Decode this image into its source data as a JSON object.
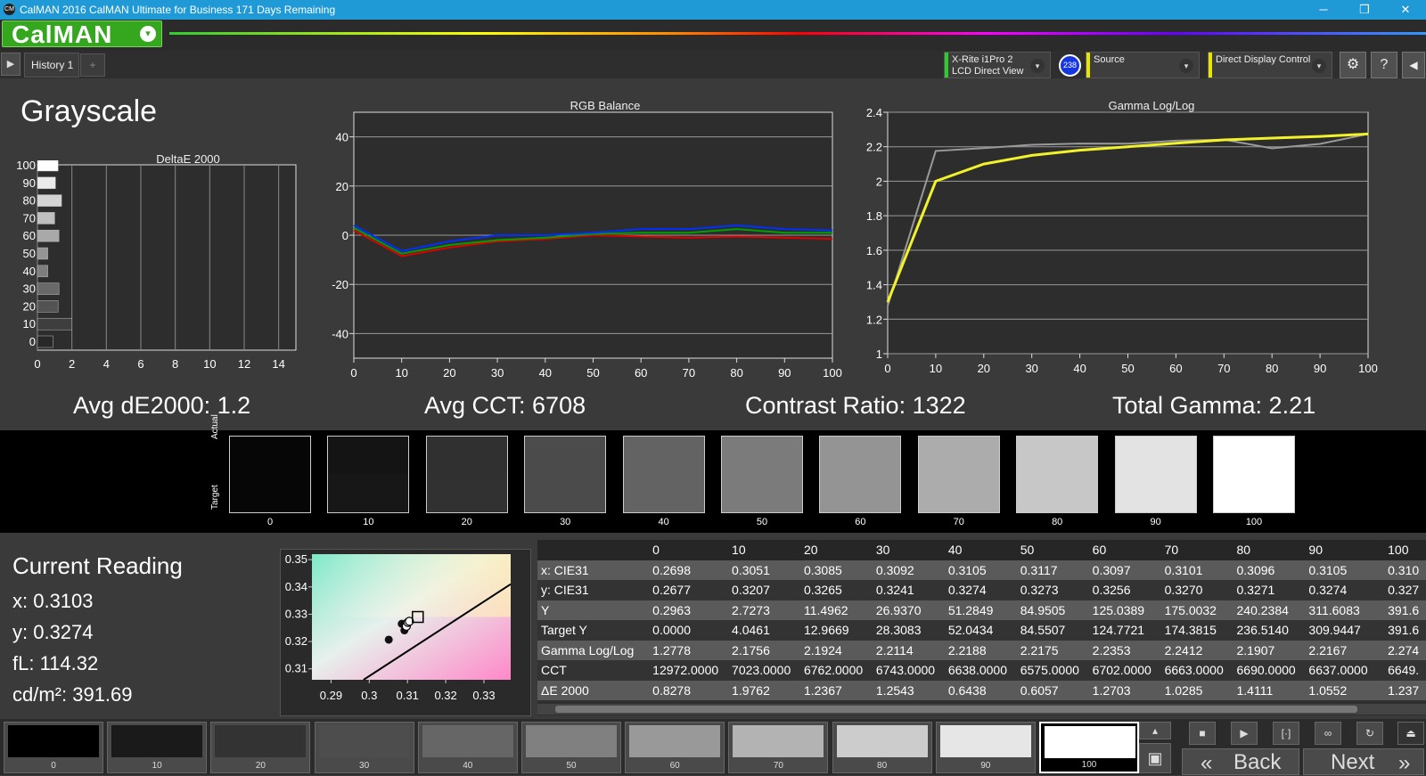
{
  "window": {
    "title": "CalMAN 2016 CalMAN Ultimate for Business 171 Days Remaining",
    "app_icon_text": "CM",
    "controls": {
      "minimize": "─",
      "maximize": "❐",
      "close": "✕"
    }
  },
  "header": {
    "logo": "CalMAN",
    "logo_dropdown": "▾"
  },
  "tabs": {
    "left_arrow": "▶",
    "history_tab": "History 1",
    "add_tab": "+",
    "meter": {
      "line1": "X-Rite i1Pro 2",
      "line2": "LCD Direct View",
      "badge": "238",
      "accent": "#2ecc2e"
    },
    "source": {
      "label": "Source",
      "accent": "#e6e600"
    },
    "display": {
      "label": "Direct Display Control",
      "accent": "#e6e600"
    },
    "settings_icon": "⚙",
    "help_icon": "?",
    "collapse_icon": "◀"
  },
  "page": {
    "title": "Grayscale"
  },
  "stats": {
    "avg_de": "Avg dE2000: 1.2",
    "avg_cct": "Avg CCT: 6708",
    "contrast": "Contrast Ratio: 1322",
    "gamma": "Total Gamma: 2.21"
  },
  "chart_data": [
    {
      "type": "bar",
      "title": "DeltaE 2000",
      "orientation": "horizontal",
      "categories": [
        "0",
        "10",
        "20",
        "30",
        "40",
        "50",
        "60",
        "70",
        "80",
        "90",
        "100"
      ],
      "values": [
        0.9,
        2.0,
        1.2,
        1.25,
        0.6,
        0.6,
        1.25,
        1.0,
        1.4,
        1.05,
        1.2
      ],
      "xlim": [
        0,
        15
      ],
      "xticks": [
        "0",
        "2",
        "4",
        "6",
        "8",
        "10",
        "12",
        "14"
      ]
    },
    {
      "type": "line",
      "title": "RGB Balance",
      "x": [
        0,
        10,
        20,
        30,
        40,
        50,
        60,
        70,
        80,
        90,
        100
      ],
      "xticks": [
        "0",
        "10",
        "20",
        "30",
        "40",
        "50",
        "60",
        "70",
        "80",
        "90",
        "100"
      ],
      "yticks": [
        "40",
        "20",
        "0",
        "-20",
        "-40"
      ],
      "ylim": [
        -50,
        50
      ],
      "series": [
        {
          "color": "#e00000",
          "values": [
            2,
            -8.5,
            -5,
            -2.5,
            -1.5,
            0,
            -0.5,
            -1,
            -0.5,
            -1,
            -1.5
          ]
        },
        {
          "color": "#00a000",
          "values": [
            3,
            -7.5,
            -4,
            -2,
            -1,
            0.5,
            1,
            1,
            2.5,
            1,
            1
          ]
        },
        {
          "color": "#0030ff",
          "values": [
            4,
            -6.5,
            -2.5,
            0,
            0,
            1,
            2.5,
            2.5,
            4,
            2.5,
            2
          ]
        }
      ]
    },
    {
      "type": "line",
      "title": "Gamma Log/Log",
      "x": [
        0,
        10,
        20,
        30,
        40,
        50,
        60,
        70,
        80,
        90,
        100
      ],
      "xticks": [
        "0",
        "10",
        "20",
        "30",
        "40",
        "50",
        "60",
        "70",
        "80",
        "90",
        "100"
      ],
      "yticks": [
        "2.4",
        "2.2",
        "2",
        "1.8",
        "1.6",
        "1.4",
        "1.2",
        "1"
      ],
      "ylim": [
        1,
        2.4
      ],
      "series": [
        {
          "color": "#999999",
          "values": [
            1.2778,
            2.1756,
            2.1924,
            2.2114,
            2.2188,
            2.2175,
            2.2353,
            2.2412,
            2.1907,
            2.2167,
            2.274
          ]
        },
        {
          "color": "#f2f22a",
          "values": [
            1.3,
            2.0,
            2.1,
            2.15,
            2.18,
            2.2,
            2.22,
            2.24,
            2.25,
            2.26,
            2.274
          ]
        }
      ]
    },
    {
      "type": "scatter",
      "title": "",
      "x_ticks": [
        "0.29",
        "0.3",
        "0.31",
        "0.32",
        "0.33"
      ],
      "y_ticks": [
        "0.35",
        "0.34",
        "0.33",
        "0.32",
        "0.31"
      ],
      "xlim": [
        0.285,
        0.337
      ],
      "ylim": [
        0.306,
        0.352
      ],
      "points": [
        {
          "x": 0.3051,
          "y": 0.3207,
          "kind": "dot"
        },
        {
          "x": 0.3085,
          "y": 0.3265,
          "kind": "dot"
        },
        {
          "x": 0.3092,
          "y": 0.3241,
          "kind": "dot"
        },
        {
          "x": 0.3097,
          "y": 0.3256,
          "kind": "ring"
        },
        {
          "x": 0.3101,
          "y": 0.327,
          "kind": "ring"
        },
        {
          "x": 0.3105,
          "y": 0.3274,
          "kind": "ring"
        },
        {
          "x": 0.3127,
          "y": 0.329,
          "kind": "target"
        }
      ]
    }
  ],
  "swatches": {
    "actual_label": "Actual",
    "target_label": "Target",
    "items": [
      {
        "label": "0",
        "actual": "#060606",
        "target": "#060606"
      },
      {
        "label": "10",
        "actual": "#141414",
        "target": "#171717"
      },
      {
        "label": "20",
        "actual": "#303030",
        "target": "#313131"
      },
      {
        "label": "30",
        "actual": "#4b4b4b",
        "target": "#4b4b4b"
      },
      {
        "label": "40",
        "actual": "#636363",
        "target": "#636363"
      },
      {
        "label": "50",
        "actual": "#7b7b7b",
        "target": "#7b7b7b"
      },
      {
        "label": "60",
        "actual": "#949494",
        "target": "#949494"
      },
      {
        "label": "70",
        "actual": "#acacac",
        "target": "#acacac"
      },
      {
        "label": "80",
        "actual": "#c7c7c7",
        "target": "#c7c7c7"
      },
      {
        "label": "90",
        "actual": "#e3e3e3",
        "target": "#e3e3e3"
      },
      {
        "label": "100",
        "actual": "#ffffff",
        "target": "#ffffff"
      }
    ]
  },
  "current": {
    "title": "Current Reading",
    "x": "x: 0.3103",
    "y": "y: 0.3274",
    "fl": "fL: 114.32",
    "cdm2": "cd/m²: 391.69"
  },
  "table": {
    "headers": [
      "",
      "0",
      "10",
      "20",
      "30",
      "40",
      "50",
      "60",
      "70",
      "80",
      "90",
      "100"
    ],
    "rows": [
      [
        "x: CIE31",
        "0.2698",
        "0.3051",
        "0.3085",
        "0.3092",
        "0.3105",
        "0.3117",
        "0.3097",
        "0.3101",
        "0.3096",
        "0.3105",
        "0.310"
      ],
      [
        "y: CIE31",
        "0.2677",
        "0.3207",
        "0.3265",
        "0.3241",
        "0.3274",
        "0.3273",
        "0.3256",
        "0.3270",
        "0.3271",
        "0.3274",
        "0.327"
      ],
      [
        "Y",
        "0.2963",
        "2.7273",
        "11.4962",
        "26.9370",
        "51.2849",
        "84.9505",
        "125.0389",
        "175.0032",
        "240.2384",
        "311.6083",
        "391.6"
      ],
      [
        "Target Y",
        "0.0000",
        "4.0461",
        "12.9669",
        "28.3083",
        "52.0434",
        "84.5507",
        "124.7721",
        "174.3815",
        "236.5140",
        "309.9447",
        "391.6"
      ],
      [
        "Gamma Log/Log",
        "1.2778",
        "2.1756",
        "2.1924",
        "2.2114",
        "2.2188",
        "2.2175",
        "2.2353",
        "2.2412",
        "2.1907",
        "2.2167",
        "2.274"
      ],
      [
        "CCT",
        "12972.0000",
        "7023.0000",
        "6762.0000",
        "6743.0000",
        "6638.0000",
        "6575.0000",
        "6702.0000",
        "6663.0000",
        "6690.0000",
        "6637.0000",
        "6649."
      ],
      [
        "ΔE 2000",
        "0.8278",
        "1.9762",
        "1.2367",
        "1.2543",
        "0.6438",
        "0.6057",
        "1.2703",
        "1.0285",
        "1.4111",
        "1.0552",
        "1.237"
      ]
    ]
  },
  "bottom": {
    "patches": [
      {
        "label": "0",
        "color": "#000000"
      },
      {
        "label": "10",
        "color": "#1a1a1a"
      },
      {
        "label": "20",
        "color": "#333333"
      },
      {
        "label": "30",
        "color": "#4d4d4d"
      },
      {
        "label": "40",
        "color": "#666666"
      },
      {
        "label": "50",
        "color": "#808080"
      },
      {
        "label": "60",
        "color": "#999999"
      },
      {
        "label": "70",
        "color": "#b3b3b3"
      },
      {
        "label": "80",
        "color": "#cccccc"
      },
      {
        "label": "90",
        "color": "#e6e6e6"
      },
      {
        "label": "100",
        "color": "#ffffff"
      }
    ],
    "back": "Back",
    "next": "Next",
    "icons": {
      "eject": "⏏",
      "stop": "■",
      "play": "▶",
      "range": "[·]",
      "loop": "∞",
      "refresh": "↻",
      "back_arrows": "«",
      "next_arrows": "»",
      "capture": "▣",
      "scroll_up": "▴",
      "scroll_down": "▾"
    }
  }
}
